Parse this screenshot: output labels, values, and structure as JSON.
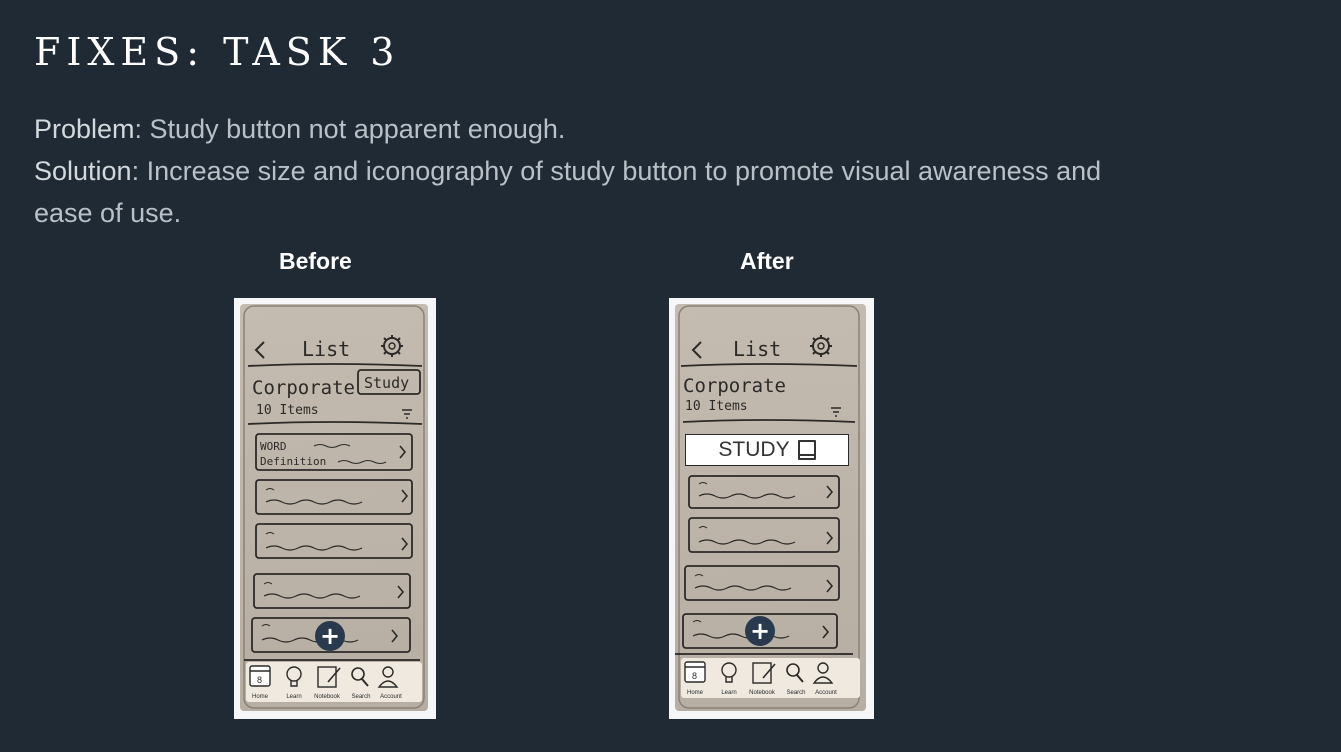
{
  "slide": {
    "title": "FIXES: TASK 3",
    "problem_term": "Problem",
    "problem_text": ": Study button not apparent enough.",
    "solution_term": "Solution",
    "solution_text": ": Increase size and iconography of study button to promote visual awareness and ease of use."
  },
  "before": {
    "label": "Before",
    "header_title": "List",
    "list_name": "Corporate",
    "item_count": "10 Items",
    "study_label": "Study",
    "first_item_word": "WORD",
    "first_item_definition": "Definition",
    "tabs": [
      "Home",
      "Learn",
      "Notebook",
      "Search",
      "Account"
    ],
    "calendar_day": "8"
  },
  "after": {
    "label": "After",
    "header_title": "List",
    "list_name": "Corporate",
    "item_count": "10 Items",
    "study_label": "STUDY",
    "tabs": [
      "Home",
      "Learn",
      "Notebook",
      "Search",
      "Account"
    ],
    "calendar_day": "8"
  },
  "colors": {
    "background": "#1f2a34",
    "title": "#ffffff",
    "body_text": "#b9c0c7",
    "fab": "#2a3a4e"
  }
}
